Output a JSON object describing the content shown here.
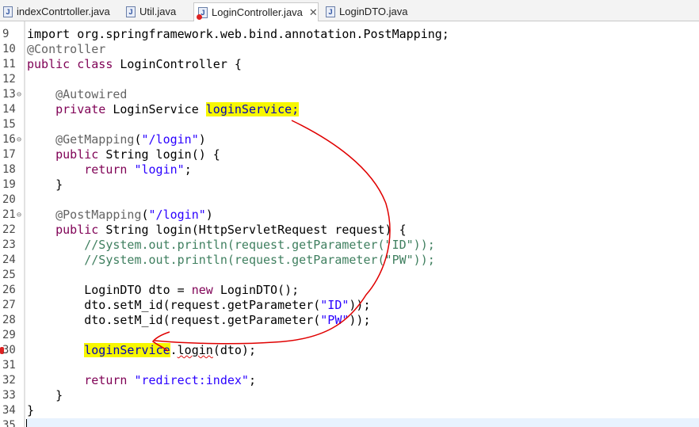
{
  "tabs": [
    {
      "label": "indexContrtoller.java",
      "active": false,
      "error": false
    },
    {
      "label": "Util.java",
      "active": false,
      "error": false
    },
    {
      "label": "LoginController.java",
      "active": true,
      "error": true,
      "close_glyph": "✕"
    },
    {
      "label": "LoginDTO.java",
      "active": false,
      "error": false
    }
  ],
  "editor": {
    "top_partial_line": "import org.springframework.web.bind.annotation.PostMapping;",
    "lines": [
      {
        "n": "9",
        "text": ""
      },
      {
        "n": "10",
        "text": "@Controller"
      },
      {
        "n": "11",
        "text": "public class LoginController {"
      },
      {
        "n": "12",
        "text": ""
      },
      {
        "n": "13",
        "text": "    @Autowired",
        "fold": true
      },
      {
        "n": "14",
        "text": "    private LoginService loginService;"
      },
      {
        "n": "15",
        "text": ""
      },
      {
        "n": "16",
        "text": "    @GetMapping(\"/login\")",
        "fold": true
      },
      {
        "n": "17",
        "text": "    public String login() {"
      },
      {
        "n": "18",
        "text": "        return \"login\";"
      },
      {
        "n": "19",
        "text": "    }"
      },
      {
        "n": "20",
        "text": ""
      },
      {
        "n": "21",
        "text": "    @PostMapping(\"/login\")",
        "fold": true
      },
      {
        "n": "22",
        "text": "    public String login(HttpServletRequest request) {"
      },
      {
        "n": "23",
        "text": "        //System.out.println(request.getParameter(\"ID\"));"
      },
      {
        "n": "24",
        "text": "        //System.out.println(request.getParameter(\"PW\"));"
      },
      {
        "n": "25",
        "text": ""
      },
      {
        "n": "26",
        "text": "        LoginDTO dto = new LoginDTO();"
      },
      {
        "n": "27",
        "text": "        dto.setM_id(request.getParameter(\"ID\"));"
      },
      {
        "n": "28",
        "text": "        dto.setM_id(request.getParameter(\"PW\"));"
      },
      {
        "n": "29",
        "text": ""
      },
      {
        "n": "30",
        "text": "        loginService.login(dto);",
        "error": true
      },
      {
        "n": "31",
        "text": ""
      },
      {
        "n": "32",
        "text": "        return \"redirect:index\";"
      },
      {
        "n": "33",
        "text": "    }"
      },
      {
        "n": "34",
        "text": "}"
      },
      {
        "n": "35",
        "text": ""
      }
    ]
  },
  "colors": {
    "keyword": "#7f0055",
    "annotation": "#646464",
    "string": "#2a00ff",
    "comment": "#3f7f5f",
    "highlight": "#f7f700",
    "annotation_stroke": "#e00000"
  }
}
